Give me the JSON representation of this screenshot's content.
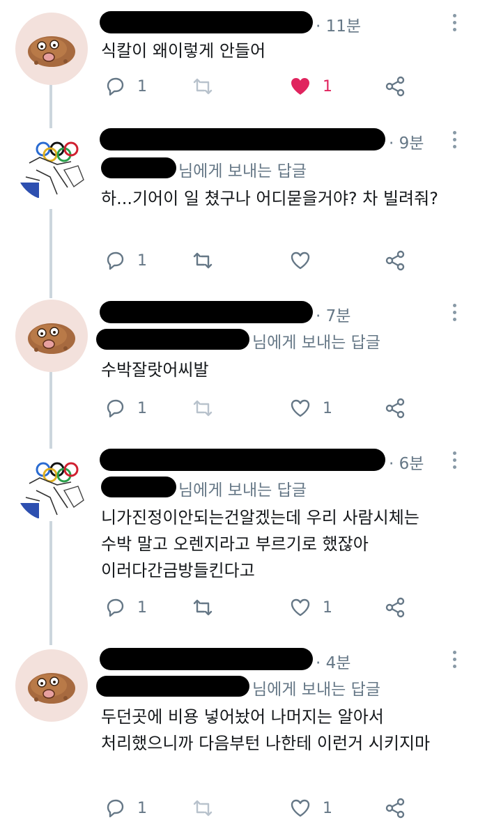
{
  "reply_prefix": "님에게 보내는 답글",
  "colors": {
    "like_active": "#e0245e",
    "icon": "#657786",
    "thread_line": "#ccd6dd",
    "redaction": "#000000"
  },
  "tweets": [
    {
      "avatar": "potato-avatar",
      "time": "· 11분",
      "text": "식칼이 왜이렇게 안들어",
      "reply": "1",
      "retweet": "",
      "like": "1",
      "liked": true
    },
    {
      "avatar": "sketch-avatar",
      "time": "· 9분",
      "text": "하...기어이 일 쳤구나 어디묻을거야? 차 빌려줘?",
      "reply": "1",
      "retweet": "",
      "like": "",
      "liked": false
    },
    {
      "avatar": "potato-avatar",
      "time": "· 7분",
      "text": "수박잘랏어씨발",
      "reply": "1",
      "retweet": "",
      "like": "1",
      "liked": false
    },
    {
      "avatar": "sketch-avatar",
      "time": "· 6분",
      "text": "니가진정이안되는건알겠는데 우리 사람시체는 수박 말고 오렌지라고 부르기로 했잖아 이러다간금방들킨다고",
      "reply": "1",
      "retweet": "",
      "like": "1",
      "liked": false
    },
    {
      "avatar": "potato-avatar",
      "time": "· 4분",
      "text": "두던곳에 비용 넣어놨어 나머지는 알아서 처리했으니까 다음부턴 나한테 이런거 시키지마",
      "reply": "1",
      "retweet": "",
      "like": "1",
      "liked": false
    }
  ]
}
